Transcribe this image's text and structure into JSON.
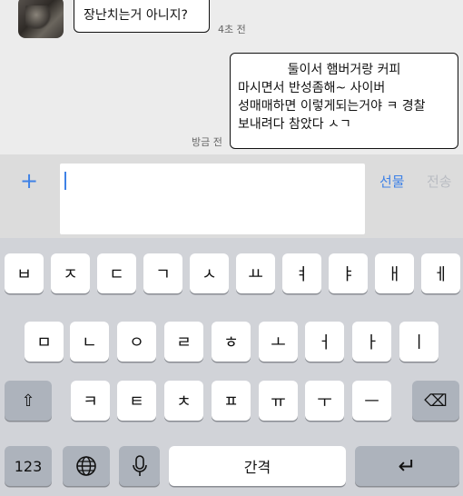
{
  "chat": {
    "incoming": {
      "text": "장난치는거 아니지?",
      "time": "4초 전"
    },
    "outgoing": {
      "lines": [
        "둘이서 햄버거랑 커피",
        "마시면서 반성좀해~ 사이버",
        "성매매하면 이렇게되는거야 ㅋ 경찰",
        "보내려다 참았다 ㅅㄱ"
      ],
      "time": "방금 전"
    }
  },
  "input": {
    "plus": "+",
    "gift": "선물",
    "send": "전송",
    "value": ""
  },
  "keyboard": {
    "row1": [
      "ㅂ",
      "ㅈ",
      "ㄷ",
      "ㄱ",
      "ㅅ",
      "ㅛ",
      "ㅕ",
      "ㅑ",
      "ㅐ",
      "ㅔ"
    ],
    "row2": [
      "ㅁ",
      "ㄴ",
      "ㅇ",
      "ㄹ",
      "ㅎ",
      "ㅗ",
      "ㅓ",
      "ㅏ",
      "ㅣ"
    ],
    "row3": [
      "ㅋ",
      "ㅌ",
      "ㅊ",
      "ㅍ",
      "ㅠ",
      "ㅜ",
      "ㅡ"
    ],
    "shift": "⇧",
    "backspace": "⌫",
    "numbers": "123",
    "globe": "globe-icon",
    "mic": "microphone-icon",
    "space": "간격",
    "return": "↵"
  },
  "colors": {
    "accent": "#3f82e6",
    "muted": "#b9bcc2",
    "fnkey": "#adb3bc"
  }
}
